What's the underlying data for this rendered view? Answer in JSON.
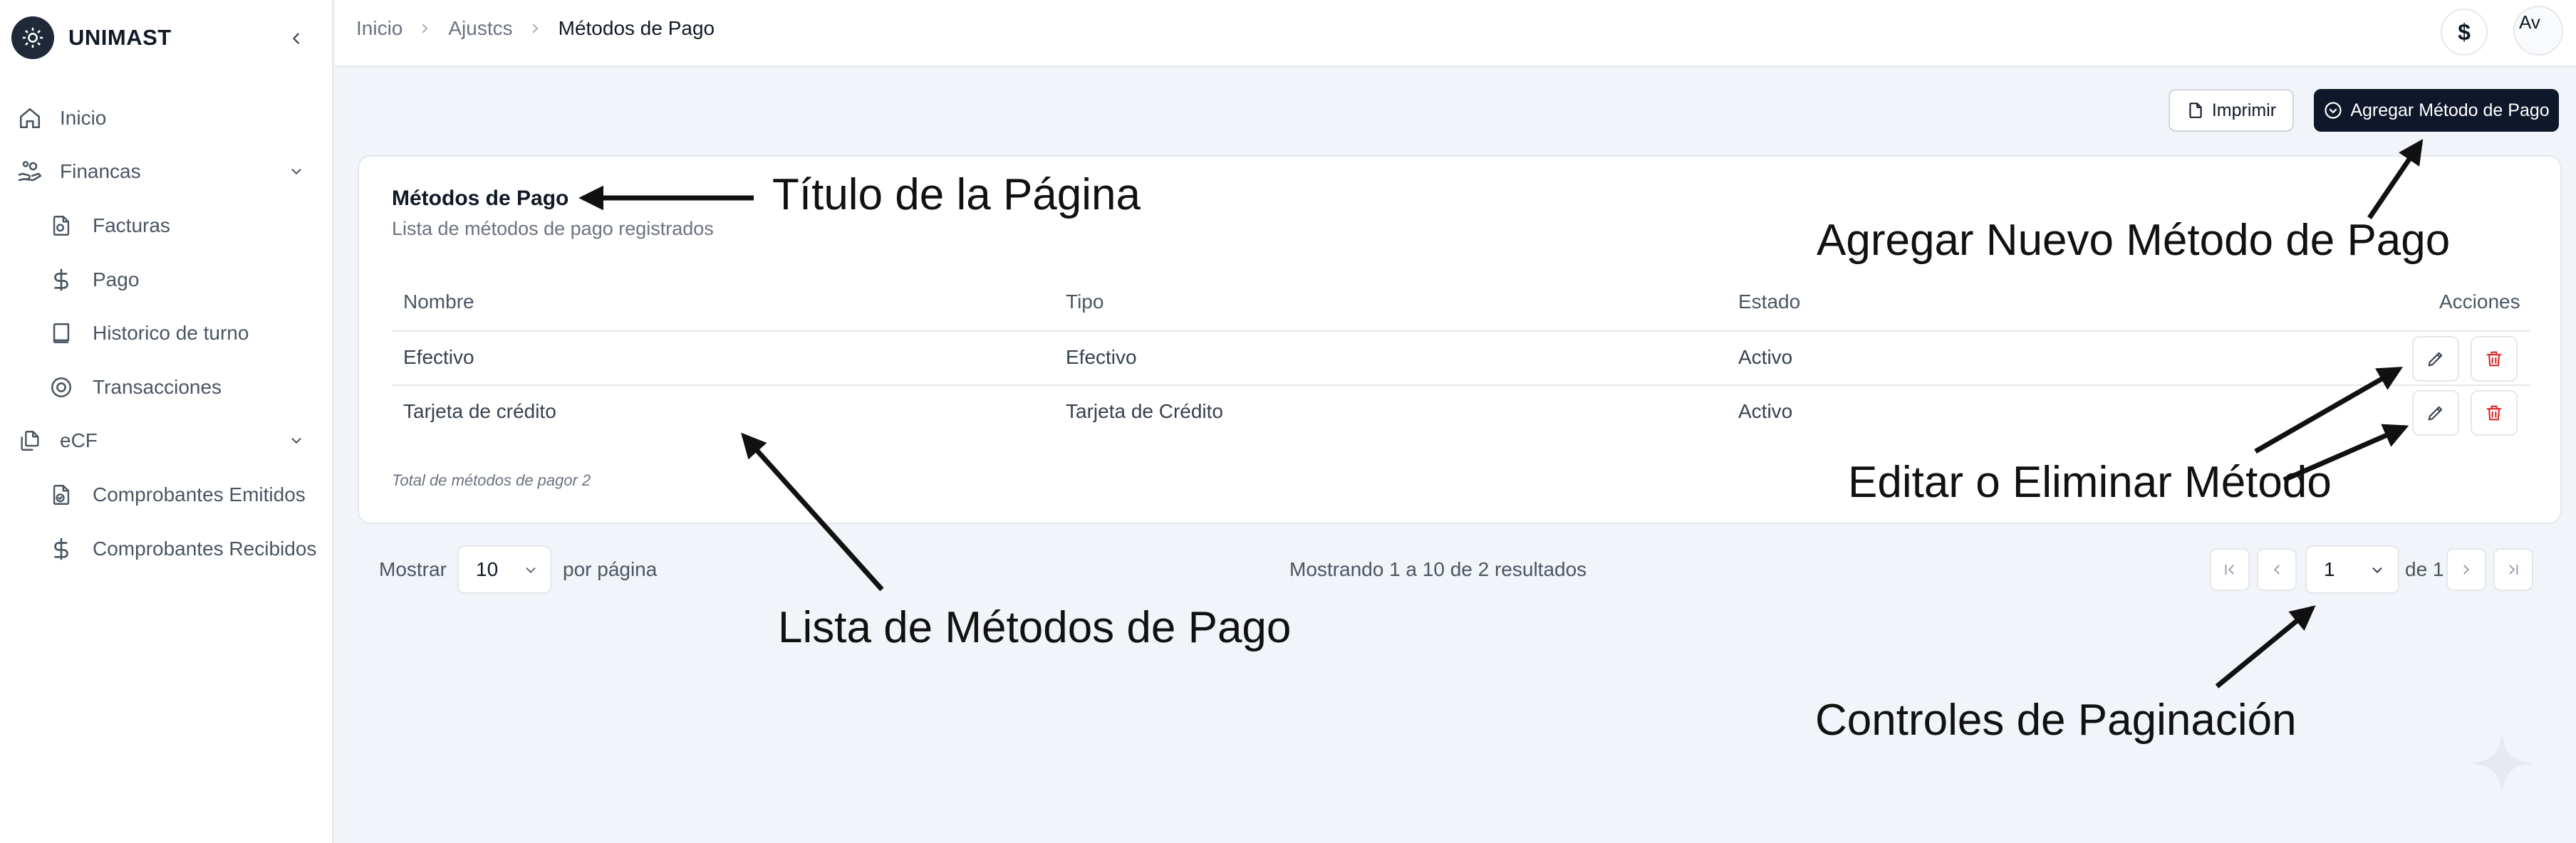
{
  "app": {
    "brand": "UNIMAST"
  },
  "sidebar": {
    "items": [
      {
        "label": "Inicio",
        "icon": "home-icon"
      },
      {
        "label": "Financas",
        "icon": "hand-coins-icon"
      },
      {
        "label": "Facturas",
        "icon": "file-coins-icon"
      },
      {
        "label": "Pago",
        "icon": "dollar-icon"
      },
      {
        "label": "Historico de turno",
        "icon": "book-icon"
      },
      {
        "label": "Transacciones",
        "icon": "coins-circle-icon"
      },
      {
        "label": "eCF",
        "icon": "file-stack-icon"
      },
      {
        "label": "Comprobantes Emitidos",
        "icon": "file-check-icon"
      },
      {
        "label": "Comprobantes Recibidos",
        "icon": "dollar-icon"
      }
    ]
  },
  "header": {
    "breadcrumb": [
      "Inicio",
      "Ajustcs",
      "Métodos de Pago"
    ],
    "currency_symbol": "$",
    "avatar_alt": "Av"
  },
  "actions": {
    "print_label": "Imprimir",
    "add_label": "Agregar Método de Pago"
  },
  "card": {
    "title": "Métodos de Pago",
    "subtitle": "Lista de métodos de pago registrados",
    "columns": [
      "Nombre",
      "Tipo",
      "Estado",
      "Acciones"
    ],
    "rows": [
      {
        "nombre": "Efectivo",
        "tipo": "Efectivo",
        "estado": "Activo"
      },
      {
        "nombre": "Tarjeta de crédito",
        "tipo": "Tarjeta de Crédito",
        "estado": "Activo"
      }
    ],
    "total_note": "Total de métodos de pagor 2"
  },
  "pagination": {
    "show_label": "Mostrar",
    "page_size": "10",
    "per_page_label": "por página",
    "results_text": "Mostrando 1 a 10 de 2 resultados",
    "current_page": "1",
    "of_label": "de 1"
  },
  "annotations": {
    "title": "Título de la Página",
    "add": "Agregar Nuevo Método de Pago",
    "list": "Lista de Métodos de Pago",
    "edit_delete": "Editar o Eliminar Método",
    "pagination": "Controles de Paginación"
  },
  "colors": {
    "primary": "#0f172a",
    "danger": "#dc2626",
    "background": "#f1f4f8",
    "text_muted": "#6b7280"
  }
}
